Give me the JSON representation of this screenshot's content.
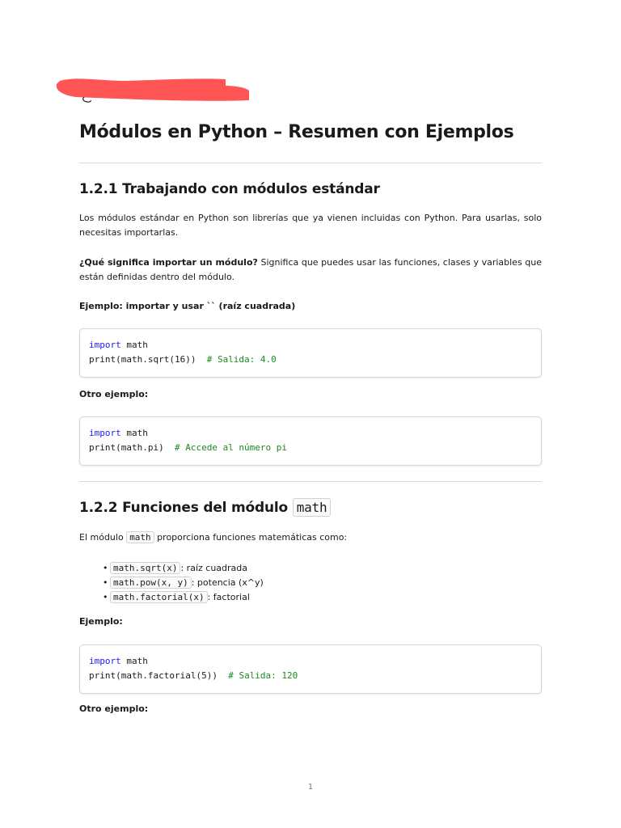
{
  "doc": {
    "title": "Módulos en Python – Resumen con Ejemplos",
    "page_number": "1"
  },
  "section1": {
    "heading": "1.2.1 Trabajando con módulos estándar",
    "intro": "Los módulos estándar en Python son librerías que ya vienen incluidas con Python. Para usarlas, solo necesitas importarlas.",
    "question_bold": "¿Qué significa importar un módulo?",
    "question_text": " Significa que puedes usar las funciones, clases y variables que están definidas dentro del módulo.",
    "example1_label": "Ejemplo: importar y usar `` (raíz cuadrada)",
    "code1": {
      "line1_kw": "import",
      "line1_rest": " math",
      "line2_code": "print(math.sqrt(16))",
      "line2_comment": "  # Salida: 4.0"
    },
    "example2_label": "Otro ejemplo:",
    "code2": {
      "line1_kw": "import",
      "line1_rest": " math",
      "line2_code": "print(math.pi)",
      "line2_comment": "  # Accede al número pi"
    }
  },
  "section2": {
    "heading_text": "1.2.2 Funciones del módulo ",
    "heading_code": "math",
    "intro_pre": "El módulo ",
    "intro_code": "math",
    "intro_post": " proporciona funciones matemáticas como:",
    "items": [
      {
        "code": "math.sqrt(x)",
        "text": ": raíz cuadrada"
      },
      {
        "code": "math.pow(x, y)",
        "text": ": potencia (x^y)"
      },
      {
        "code": "math.factorial(x)",
        "text": ": factorial"
      }
    ],
    "example_label": "Ejemplo:",
    "code3": {
      "line1_kw": "import",
      "line1_rest": " math",
      "line2_code": "print(math.factorial(5))",
      "line2_comment": "  # Salida: 120"
    },
    "other_label": "Otro ejemplo:"
  },
  "colors": {
    "redaction": "#ff5555",
    "keyword": "#1a1aff",
    "comment": "#1a8a1a",
    "rule": "#dcdcdc"
  }
}
